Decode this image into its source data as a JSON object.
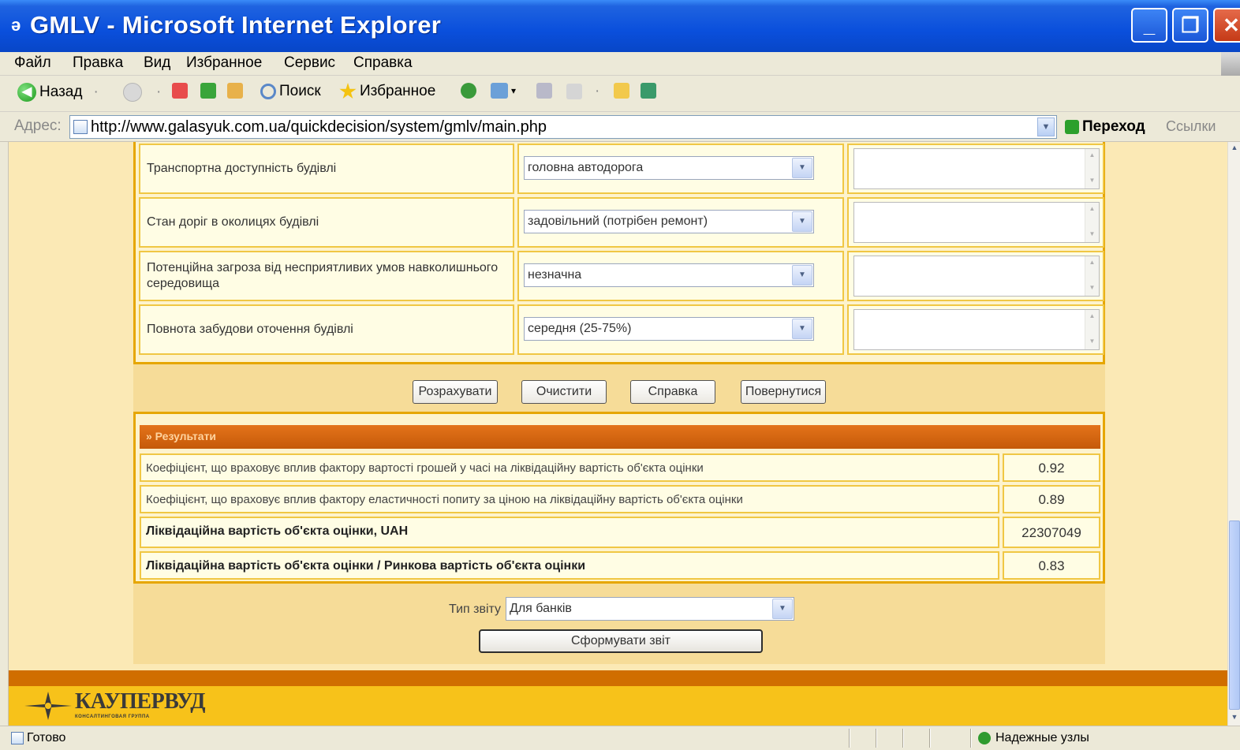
{
  "window": {
    "title": "GMLV - Microsoft Internet Explorer",
    "controls": {
      "minimize": "_",
      "maximize": "❐",
      "close": "✕"
    }
  },
  "menu": [
    "Файл",
    "Правка",
    "Вид",
    "Избранное",
    "Сервис",
    "Справка"
  ],
  "toolbar": {
    "back": "Назад",
    "search": "Поиск",
    "favorites": "Избранное"
  },
  "address": {
    "label": "Адрес:",
    "url": "http://www.galasyuk.com.ua/quickdecision/system/gmlv/main.php",
    "go": "Переход",
    "links": "Ссылки"
  },
  "form": {
    "rows": [
      {
        "label": "Транспортна доступність будівлі",
        "value": "головна автодорога",
        "comment": ""
      },
      {
        "label": "Стан доріг в околицях будівлі",
        "value": "задовільний (потрібен ремонт)",
        "comment": ""
      },
      {
        "label": "Потенційна загроза від несприятливих умов навколишнього середовища",
        "value": "незначна",
        "comment": ""
      },
      {
        "label": "Повнота забудови оточення будівлі",
        "value": "середня (25-75%)",
        "comment": ""
      }
    ],
    "buttons": {
      "calculate": "Розрахувати",
      "clear": "Очистити",
      "help": "Справка",
      "back": "Повернутися"
    }
  },
  "results": {
    "header": "» Результати",
    "rows": [
      {
        "label": "Коефіцієнт, що враховує вплив фактору вартості грошей у часі на ліквідаційну вартість об'єкта оцінки",
        "value": "0.92"
      },
      {
        "label": "Коефіцієнт, що враховує вплив фактору еластичності попиту за ціною на ліквідаційну вартість об'єкта оцінки",
        "value": "0.89"
      },
      {
        "label": "Ліквідаційна вартість об'єкта оцінки, UAH",
        "value": "22307049"
      },
      {
        "label": "Ліквідаційна вартість об'єкта оцінки / Ринкова вартість об'єкта оцінки",
        "value": "0.83"
      }
    ]
  },
  "report": {
    "label": "Тип звіту",
    "type": "Для банків",
    "generate": "Сформувати звіт"
  },
  "footer": {
    "brand": "КАУПЕРВУД",
    "tagline": "КОНСАЛТИНГОВАЯ ГРУППА"
  },
  "status": {
    "text": "Готово",
    "zone": "Надежные узлы"
  }
}
